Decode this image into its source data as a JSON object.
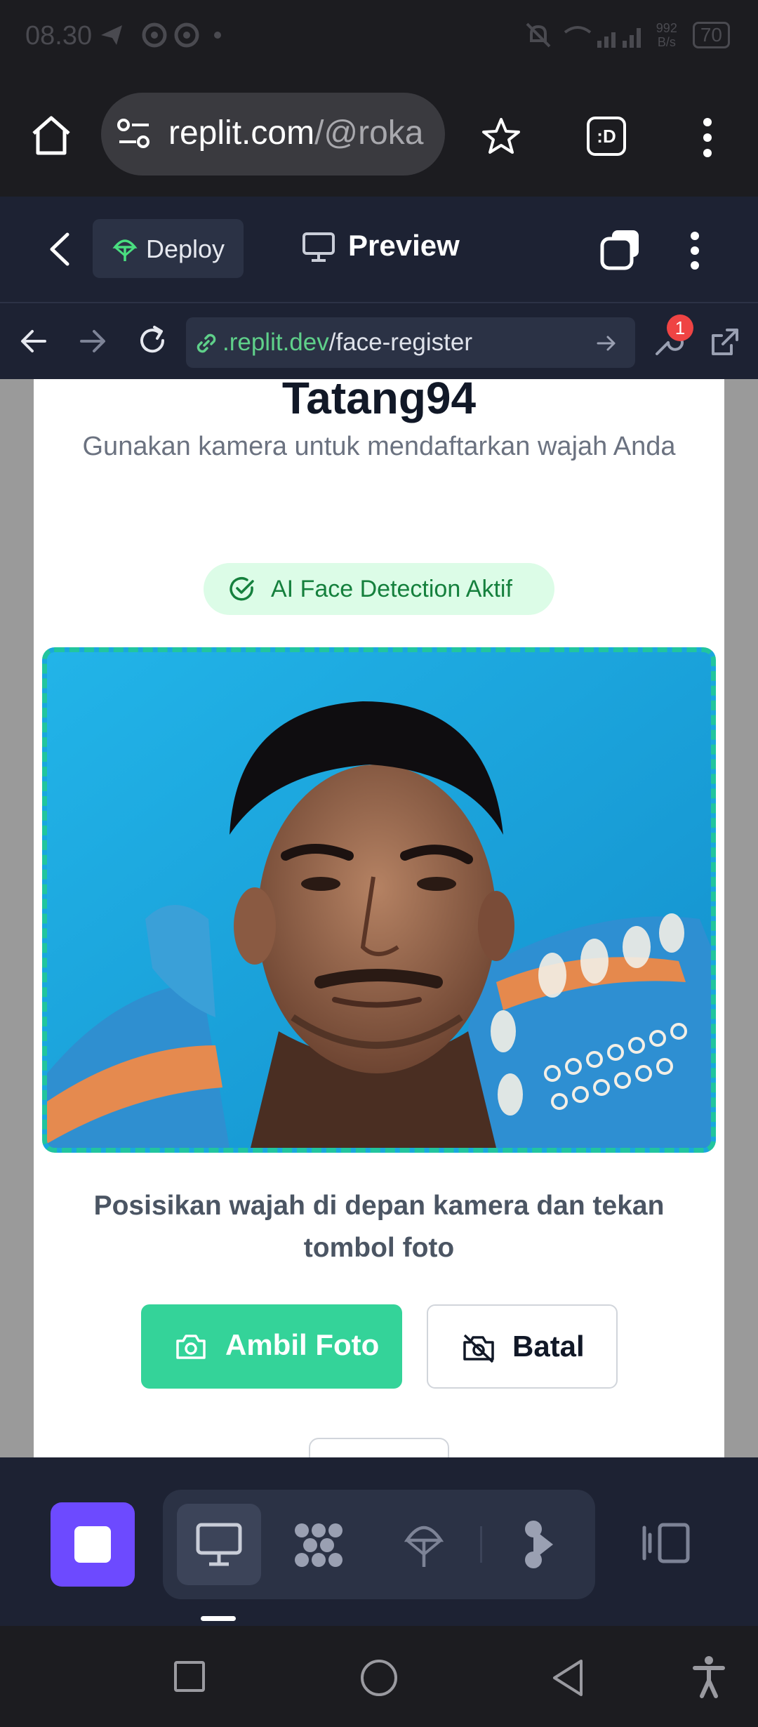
{
  "status_bar": {
    "time": "08.30",
    "net_speed_top": "992",
    "net_speed_bottom": "B/s",
    "battery": "70"
  },
  "browser": {
    "url_host": "replit.com",
    "url_path": "/@roka",
    "tab_count_icon": ":D"
  },
  "replit_toolbar": {
    "deploy_label": "Deploy",
    "preview_label": "Preview"
  },
  "webview": {
    "url_domain": ".replit.dev",
    "url_path": "/face-register",
    "devtools_badge": "1"
  },
  "page": {
    "title": "Tatang94",
    "subtitle": "Gunakan kamera untuk mendaftarkan wajah Anda",
    "ai_badge": "AI Face Detection Aktif",
    "instruction": "Posisikan wajah di depan kamera dan tekan tombol foto",
    "take_photo_label": "Ambil Foto",
    "cancel_label": "Batal"
  },
  "colors": {
    "accent_green": "#34d399",
    "camera_border": "#22c59e",
    "replit_bg": "#1d2233",
    "stop_purple": "#6d4aff"
  }
}
